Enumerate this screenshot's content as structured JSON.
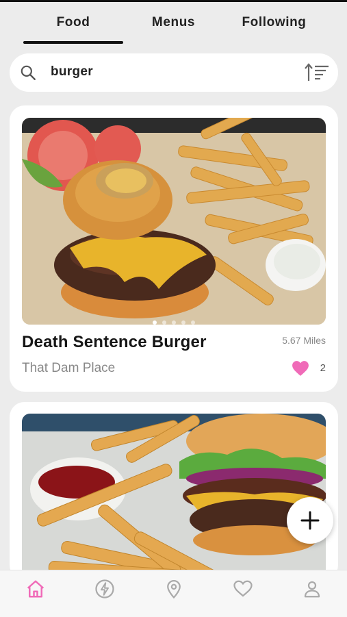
{
  "tabs": [
    {
      "label": "Food",
      "active": true
    },
    {
      "label": "Menus",
      "active": false
    },
    {
      "label": "Following",
      "active": false
    }
  ],
  "search": {
    "query": "burger",
    "icon": "search-icon",
    "sort_icon": "sort-icon"
  },
  "feed": [
    {
      "title": "Death Sentence Burger",
      "distance": "5.67 Miles",
      "place": "That Dam Place",
      "likes": "2",
      "liked": true,
      "photo_count": 5,
      "active_photo": 1
    },
    {
      "title": "",
      "image": "burger with fries and ketchup"
    }
  ],
  "fab": {
    "icon": "plus-icon"
  },
  "bottom_nav": [
    {
      "name": "home",
      "active": true
    },
    {
      "name": "bolt",
      "active": false
    },
    {
      "name": "map-pin",
      "active": false
    },
    {
      "name": "heart",
      "active": false
    },
    {
      "name": "profile",
      "active": false
    }
  ],
  "colors": {
    "accent": "#f06bb8",
    "text": "#161616",
    "muted": "#888888",
    "background": "#ececec"
  }
}
